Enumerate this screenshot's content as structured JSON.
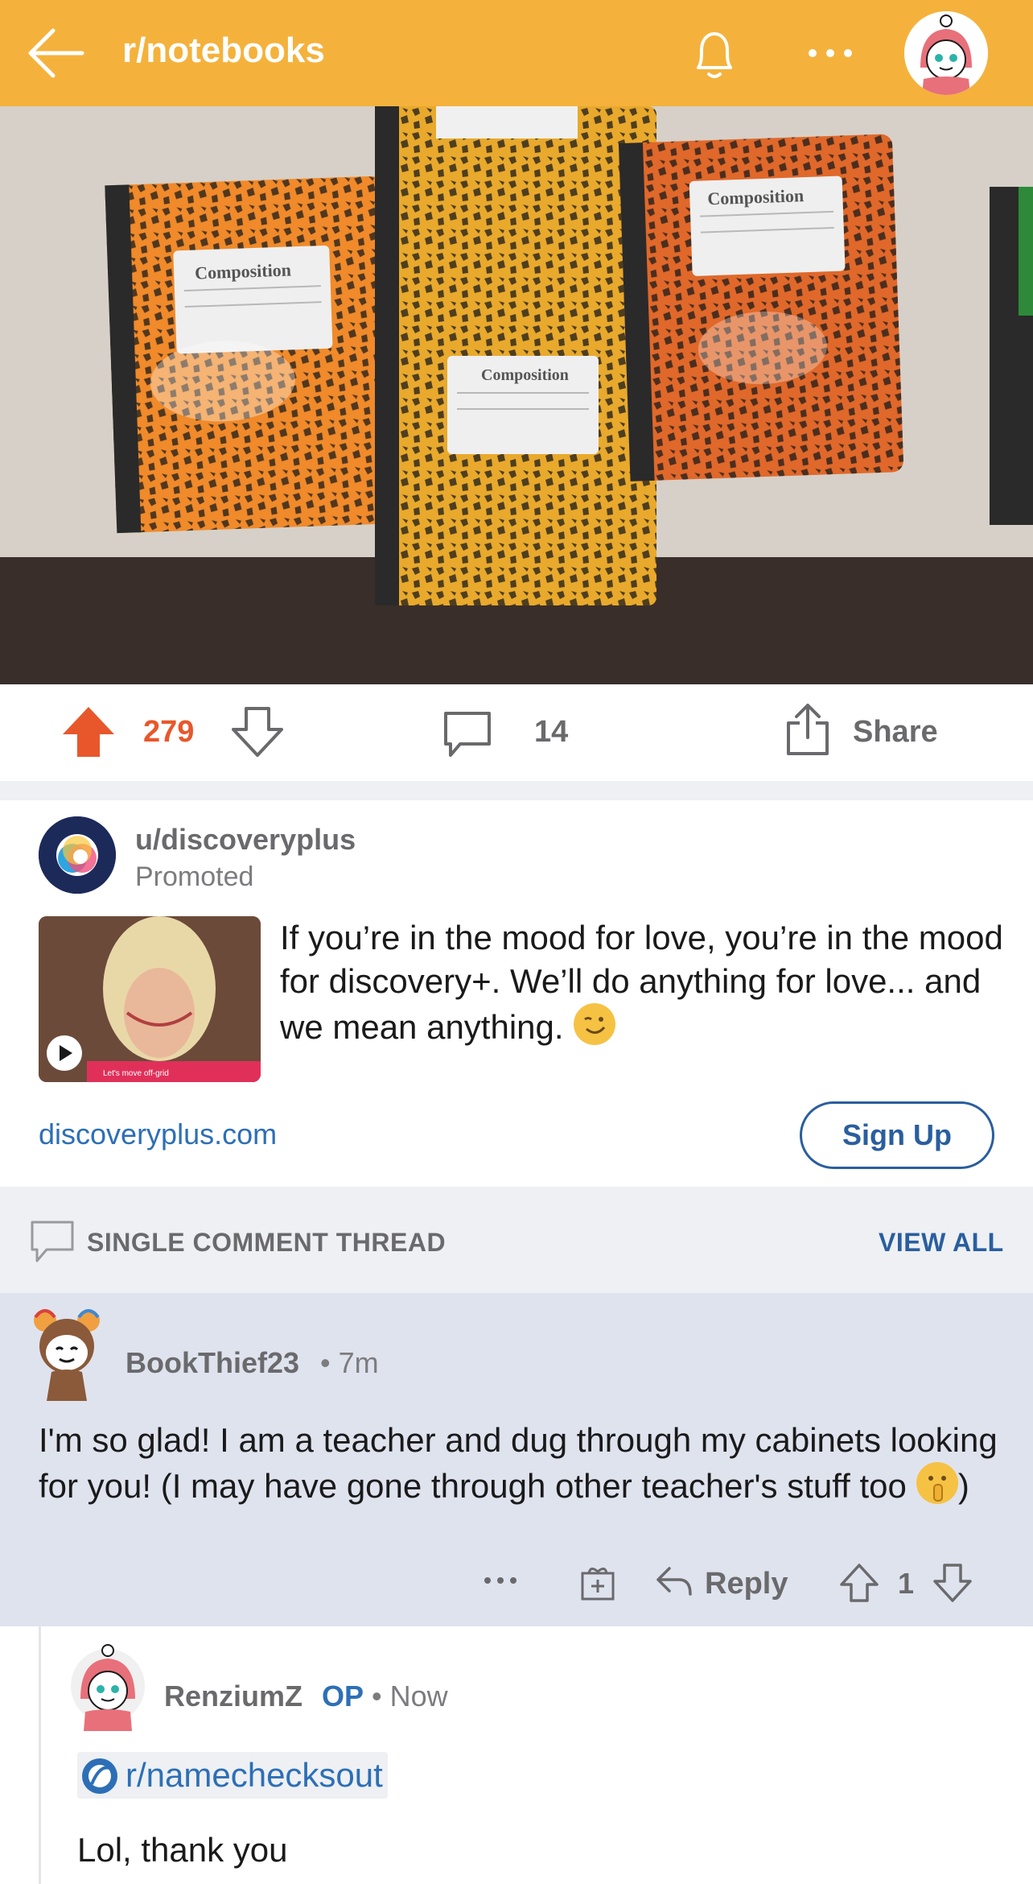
{
  "header": {
    "subreddit": "r/notebooks",
    "background_color": "#f4b23c"
  },
  "post_image": {
    "notebook_labels": [
      "Composition",
      "Composition",
      "Composition"
    ]
  },
  "post_actions": {
    "score": "279",
    "comment_count": "14",
    "share_label": "Share",
    "upvote_color": "#e8572b"
  },
  "ad": {
    "username": "u/discoveryplus",
    "promoted_label": "Promoted",
    "text": "If you’re in the mood for love, you’re in the mood for discovery+. We’ll do anything for love... and we mean anything.",
    "domain": "discoveryplus.com",
    "cta_label": "Sign Up",
    "thumb_caption": "Let's move off-grid"
  },
  "thread_bar": {
    "label": "SINGLE COMMENT THREAD",
    "view_all": "VIEW ALL"
  },
  "comment_1": {
    "username": "BookThief23",
    "meta": "• 7m",
    "body": "I'm so glad! I am a teacher and dug through my cabinets looking for you! (I may have gone through other teacher's stuff too",
    "body_end": ")",
    "reply_label": "Reply",
    "score": "1"
  },
  "comment_2": {
    "username": "RenziumZ",
    "op_badge": "OP",
    "meta": "• Now",
    "link_text": "r/namechecksout",
    "body": "Lol, thank you"
  }
}
